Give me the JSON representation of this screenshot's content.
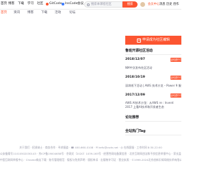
{
  "topnav": {
    "items": [
      "首页",
      "博客",
      "下载",
      "学习",
      "社区"
    ],
    "gitcode": "GitCode",
    "inscode": "InsCode",
    "more": "会议"
  },
  "search": {
    "placeholder": "搜索本课程社区",
    "button": "搜索"
  },
  "user": {
    "vip": "会员中心",
    "messages": "消息",
    "history": "历史",
    "publish": "创作"
  },
  "tabs": [
    "首页",
    "资讯",
    "博客",
    "下载",
    "活动",
    "论坛"
  ],
  "sidebar": {
    "apply_button": "申请成为社区编辑",
    "events_title": "鲁班开源社区活动",
    "events": [
      {
        "date": "2018/12/07",
        "tag": "活动进行中",
        "text": "NM中文发布社区活动"
      },
      {
        "date": "2018/10/19",
        "tag": "活动进行中",
        "text": "深圳线下活动 | AWS 技术沙龙 – Power 9 服务器实战"
      },
      {
        "date": "2017/12/09",
        "tag": "活动进行中",
        "text": "AWS AI技术沙龙：从AWS re : Invent 2017 上看AI技术和开发者生态"
      }
    ],
    "forum_title": "论坛推荐",
    "tags_title": "全站热门Tag"
  },
  "footer": {
    "row1": "关于我们 · 招贤纳士 · 商务合作 · 寻求报道 · ☎ 400-660-0108 · ✉ kefu@csdn.net · ◎ 在线客服 · 工作时间 8:30-22:00",
    "row2": "公安备案号11010502030143 · 京ICP备19004658号 · 京网文〔2020〕1039-165号 · 经营性网站备案信息 · 北京互联网违法和不良信息举报中心 · 家长监护 · 网络110报警服务",
    "row3": "中国互联网举报中心 · Chrome商店下载 · 账号管理规范 · 版权与免责声明 · 版权申诉 · 出版物许可证 · 营业执照 · ©1999-2024北京创新乐知网络技术有限公司"
  }
}
